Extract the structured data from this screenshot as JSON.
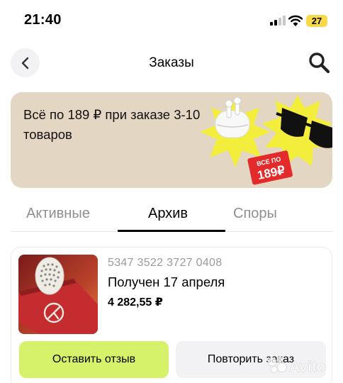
{
  "status_bar": {
    "time": "21:40",
    "battery": "27",
    "icons": [
      "signal-icon",
      "wifi-icon",
      "battery-icon"
    ]
  },
  "header": {
    "title": "Заказы",
    "back_icon": "chevron-left-icon",
    "search_icon": "search-icon"
  },
  "promo": {
    "text": "Всё по 189 ₽ при заказе 3-10 товаров",
    "sticker_line1": "ВСЕ ПО",
    "sticker_line2": "189₽"
  },
  "tabs": [
    {
      "label": "Активные",
      "active": false
    },
    {
      "label": "Архив",
      "active": true
    },
    {
      "label": "Споры",
      "active": false
    }
  ],
  "order": {
    "number": "5347 3522 3727 0408",
    "status": "Получен 17 апреля",
    "price": "4 282,55 ₽",
    "review_button": "Оставить отзыв",
    "repeat_button": "Повторить заказ"
  },
  "watermark": "Avito",
  "colors": {
    "accent_green": "#d6f26a",
    "promo_bg": "#e3d7c4",
    "promo_red": "#e32b2b",
    "promo_yellow": "#f2ee3b",
    "battery_yellow": "#f7d94a",
    "muted_text": "#8e8e93"
  }
}
